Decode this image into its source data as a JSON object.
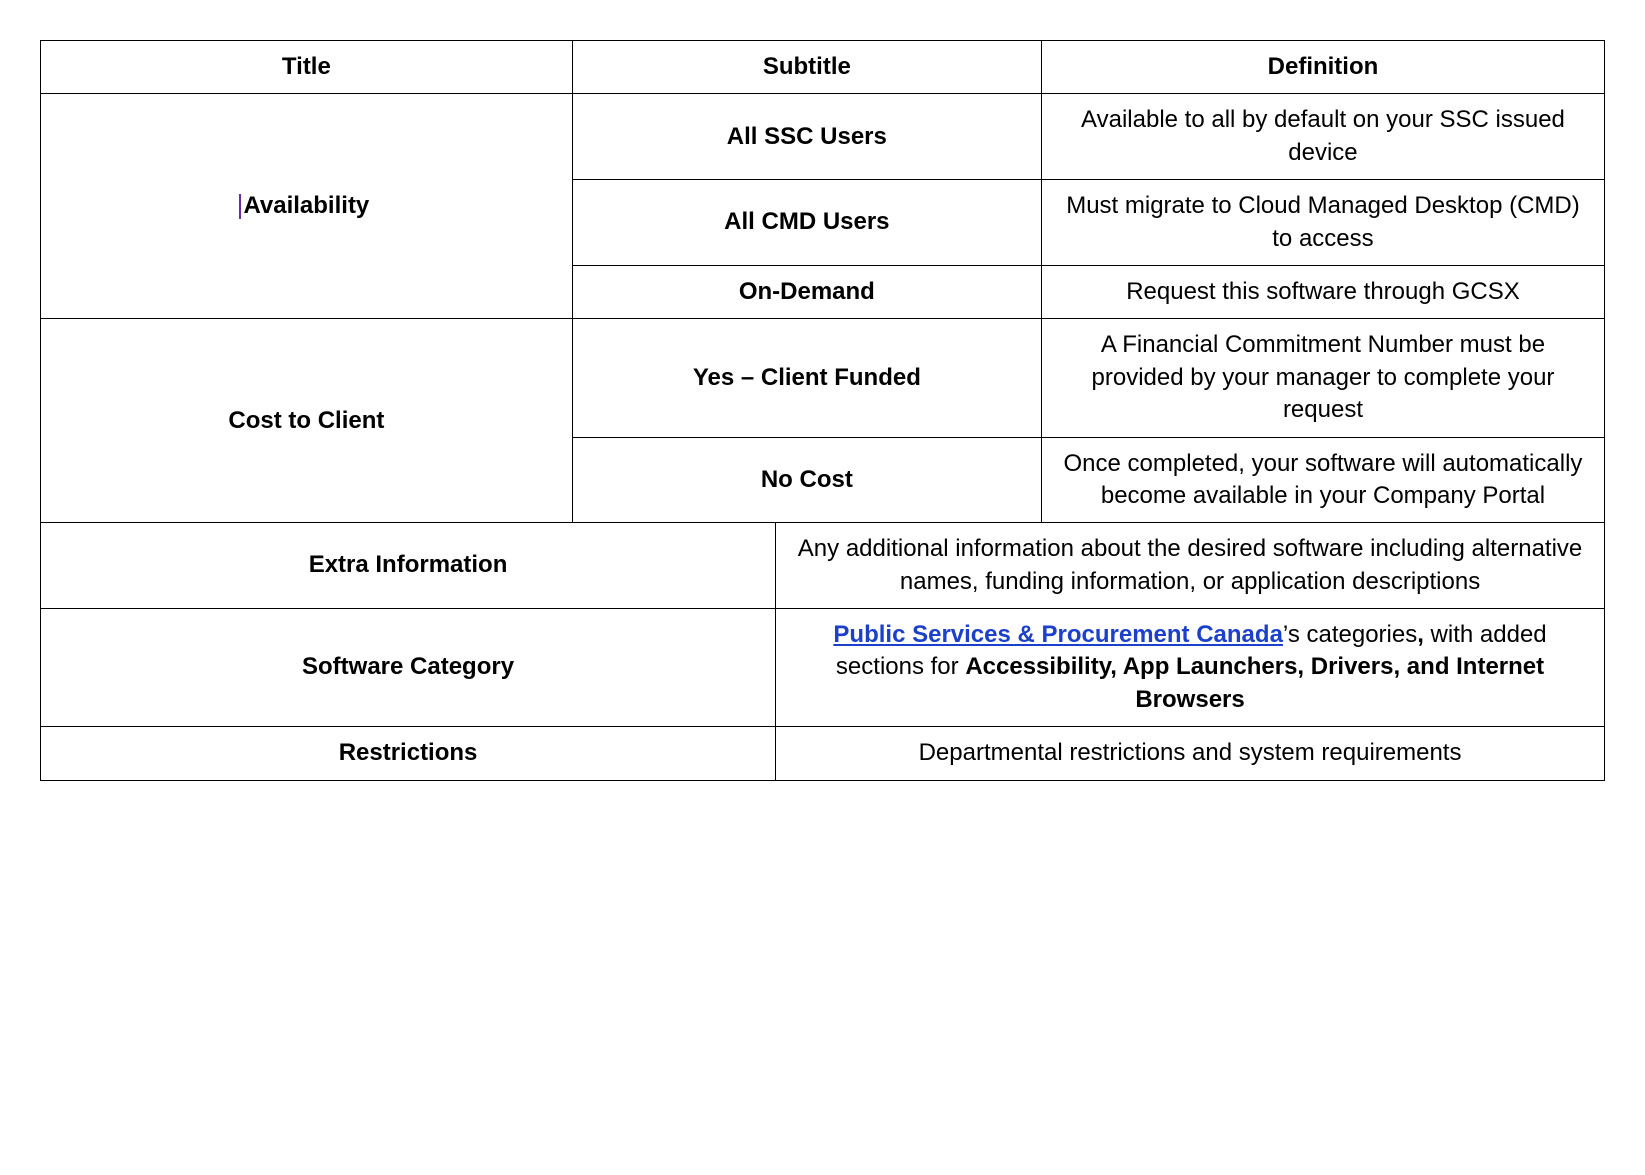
{
  "headers": {
    "title": "Title",
    "subtitle": "Subtitle",
    "definition": "Definition"
  },
  "availability": {
    "title": "Availability",
    "rows": [
      {
        "subtitle": "All SSC Users",
        "definition": "Available to all by default on your SSC issued device"
      },
      {
        "subtitle": "All CMD Users",
        "definition": "Must migrate to Cloud Managed Desktop (CMD) to access"
      },
      {
        "subtitle": "On-Demand",
        "definition": "Request this software through GCSX"
      }
    ]
  },
  "cost": {
    "title": "Cost to Client",
    "rows": [
      {
        "subtitle": "Yes – Client Funded",
        "definition": "A Financial Commitment Number must be provided by your manager to complete your request"
      },
      {
        "subtitle": "No Cost",
        "definition": "Once completed, your software will automatically become available in your Company Portal"
      }
    ]
  },
  "extra": {
    "title": "Extra Information",
    "definition": "Any additional information about the desired software including alternative names, funding information, or application descriptions"
  },
  "category": {
    "title": "Software Category",
    "link_text": "Public Services & Procurement Canada",
    "after_link": "’s categories",
    "comma_bold": ",",
    "mid_text": " with added sections for ",
    "bold_tail": "Accessibility, App Launchers, Drivers, and Internet Browsers"
  },
  "restrictions": {
    "title": "Restrictions",
    "definition": "Departmental restrictions and system requirements"
  }
}
